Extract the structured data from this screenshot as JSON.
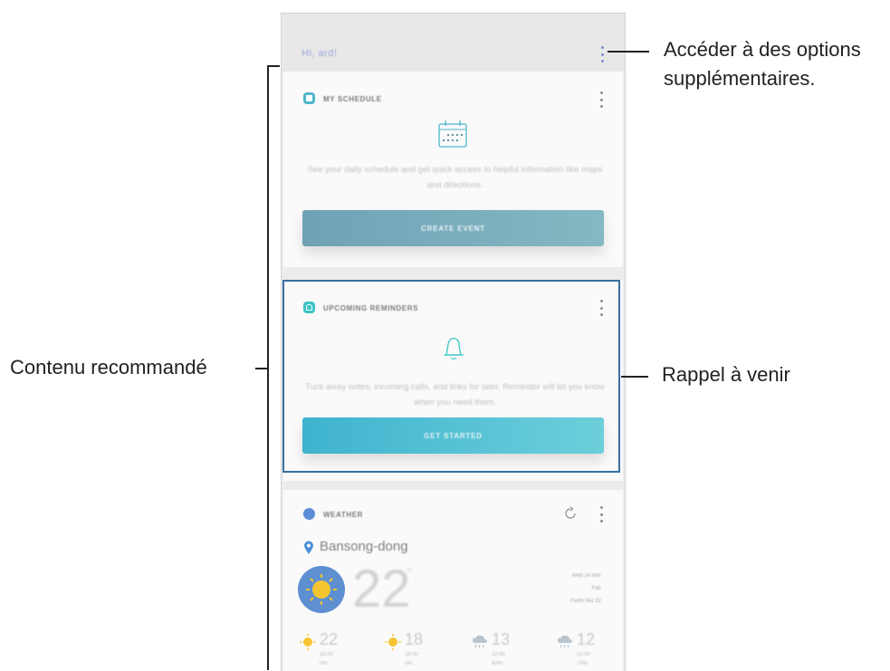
{
  "app": {
    "greeting": "Hi, ard!"
  },
  "cards": {
    "schedule": {
      "title": "MY SCHEDULE",
      "calendar_badge": "14",
      "description": "See your daily schedule and get quick access to helpful information like maps and directions.",
      "button": "CREATE EVENT"
    },
    "reminders": {
      "title": "UPCOMING REMINDERS",
      "description": "Tuck away notes, incoming calls, and links for later. Reminder will let you know when you need them.",
      "button": "GET STARTED"
    },
    "weather": {
      "title": "WEATHER",
      "location": "Bansong-dong",
      "temperature": "22",
      "degree": "°",
      "details": [
        "Wed 14 Mar",
        "Fair",
        "Feels like 22"
      ],
      "forecast": [
        {
          "icon": "sun-icon",
          "temp": "22",
          "time": "14:00",
          "rain": "0%"
        },
        {
          "icon": "sun-icon",
          "temp": "18",
          "time": "18:00",
          "rain": "0%"
        },
        {
          "icon": "rain-icon",
          "temp": "13",
          "time": "22:00",
          "rain": "60%"
        },
        {
          "icon": "rain-icon",
          "temp": "12",
          "time": "02:00",
          "rain": "70%"
        }
      ]
    }
  },
  "annotations": {
    "more_options_line1": "Accéder à des options",
    "more_options_line2": "supplémentaires.",
    "recommended": "Contenu recommandé",
    "upcoming_reminder": "Rappel à venir"
  },
  "colors": {
    "schedule_button": "#7aa9ba",
    "reminder_button": "#4ec2d4",
    "highlight_border": "#3a6fa0",
    "accent_blue": "#5b8ed6",
    "sun": "#f5c531"
  }
}
